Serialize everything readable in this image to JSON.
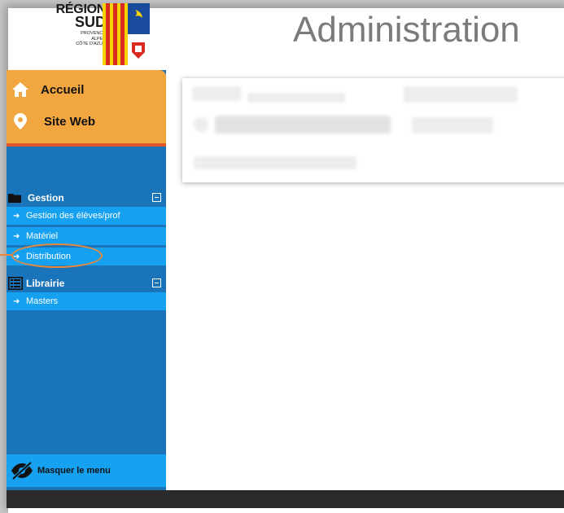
{
  "logo": {
    "line1": "RÉGION",
    "line2": "SUD",
    "line3": "PROVENCE",
    "line4": "ALPES",
    "line5": "CÔTE D'AZUR"
  },
  "header": {
    "title": "Administration"
  },
  "top_menu": [
    {
      "label": "Accueil",
      "icon": "home-icon"
    },
    {
      "label": "Site Web",
      "icon": "map-pin-icon"
    }
  ],
  "sections": [
    {
      "label": "Gestion",
      "icon": "folder-icon",
      "items": [
        {
          "label": "Gestion des élèves/prof"
        },
        {
          "label": "Matériel"
        },
        {
          "label": "Distribution"
        }
      ]
    },
    {
      "label": "Librairie",
      "icon": "list-icon",
      "items": [
        {
          "label": "Masters"
        }
      ]
    }
  ],
  "hide_menu": {
    "label": "Masquer le menu",
    "icon": "eye-slash-icon"
  },
  "colors": {
    "sidebar": "#1a74b9",
    "submenu": "#15a0f0",
    "top_menu": "#f2a63f",
    "accent": "#e2572a",
    "highlight": "#e8893c"
  }
}
